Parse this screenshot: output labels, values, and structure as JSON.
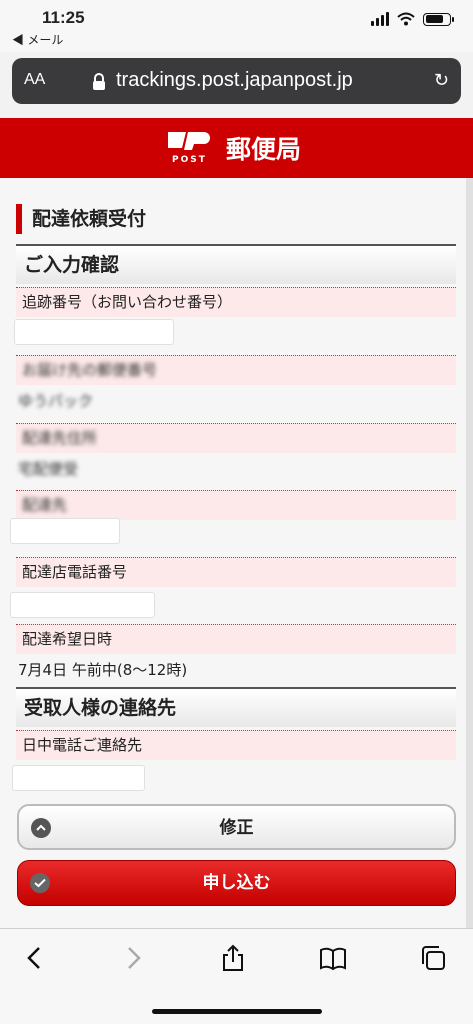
{
  "status": {
    "time": "11:25",
    "back_app": "◀ メール"
  },
  "browser": {
    "aa": "AA",
    "url": "trackings.post.japanpost.jp"
  },
  "header": {
    "logo_text": "POST",
    "brand": "郵便局"
  },
  "page": {
    "section_title": "配達依頼受付",
    "confirm_heading": "ご入力確認",
    "tracking_label": "追跡番号（お問い合わせ番号）",
    "blur1_label": "お届け先の郵便番号",
    "blur1_value": "ゆうパック",
    "blur2_label": "配達先住所",
    "blur2_value": "宅配便受",
    "blur3_label": "配達先",
    "store_phone_label": "配達店電話番号",
    "delivery_time_label": "配達希望日時",
    "delivery_time_value": "7月4日 午前中(8〜12時)",
    "recipient_heading": "受取人様の連絡先",
    "daytime_phone_label": "日中電話ご連絡先"
  },
  "buttons": {
    "fix": "修正",
    "apply": "申し込む"
  },
  "colors": {
    "brand_red": "#cc0000",
    "label_pink": "#fde9e9"
  }
}
